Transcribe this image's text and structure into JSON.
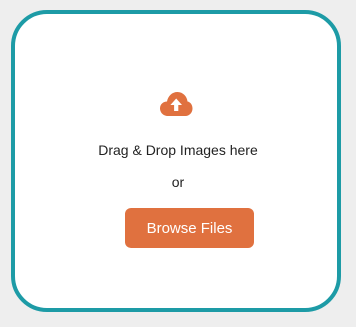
{
  "dropzone": {
    "icon": "cloud-upload-icon",
    "prompt": "Drag & Drop Images here",
    "separator": "or",
    "browse_label": "Browse Files"
  },
  "colors": {
    "border": "#1d9ba6",
    "accent": "#e0713f",
    "background": "#eeeeee",
    "panel": "#ffffff"
  }
}
